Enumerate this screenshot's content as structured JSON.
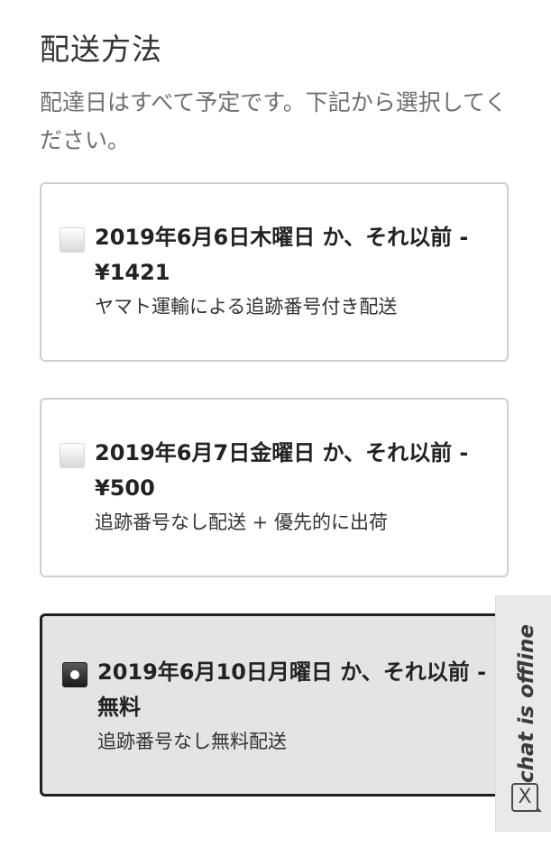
{
  "section": {
    "title": "配送方法",
    "subtitle": "配達日はすべて予定です。下記から選択してください。"
  },
  "options": [
    {
      "headline": "2019年6月6日木曜日 か、それ以前 - ¥1421",
      "description": "ヤマト運輸による追跡番号付き配送",
      "selected": false
    },
    {
      "headline": "2019年6月7日金曜日 か、それ以前 - ¥500",
      "description": "追跡番号なし配送 + 優先的に出荷",
      "selected": false
    },
    {
      "headline": "2019年6月10日月曜日 か、それ以前 - 無料",
      "description": "追跡番号なし無料配送",
      "selected": true
    }
  ],
  "chat": {
    "status_text": "chat is offline",
    "close_glyph": "X"
  }
}
